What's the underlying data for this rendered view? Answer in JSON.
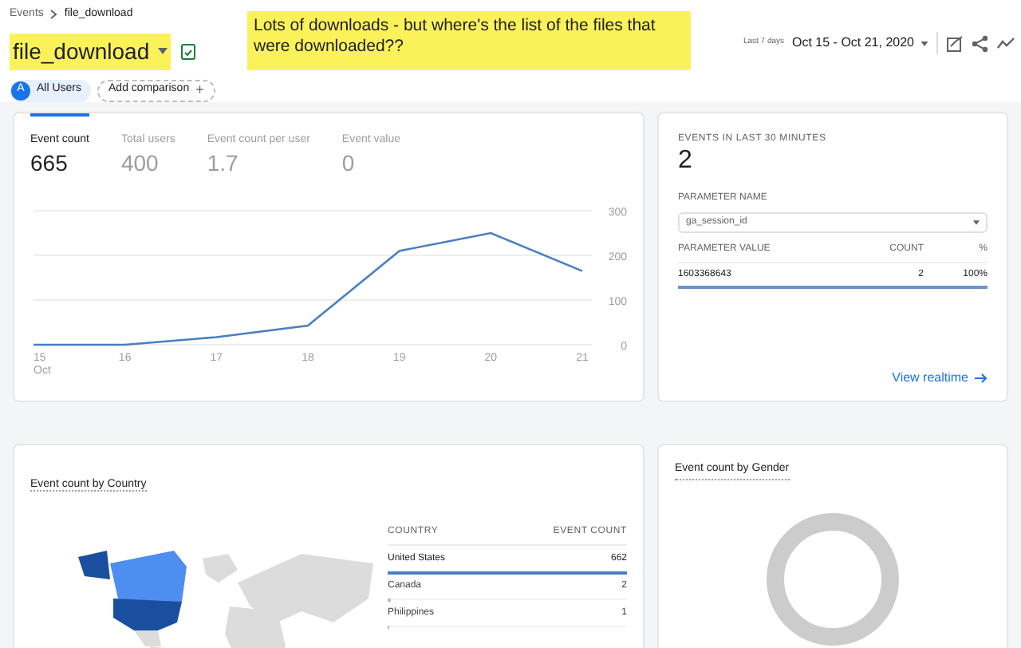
{
  "breadcrumb": [
    "Events",
    "file_download"
  ],
  "title": "file_download",
  "annotation": "Lots of downloads - but where's the list of the files that were downloaded??",
  "date_range": {
    "preset": "Last 7 days",
    "range": "Oct 15 - Oct 21, 2020"
  },
  "segments": [
    {
      "kind": "chip",
      "badge": "A",
      "label": "All Users"
    },
    {
      "kind": "add",
      "label": "Add comparison",
      "icon": "+"
    }
  ],
  "metrics": [
    {
      "label": "Event count",
      "value": "665",
      "selected": true
    },
    {
      "label": "Total users",
      "value": "400",
      "selected": false
    },
    {
      "label": "Event count per user",
      "value": "1.7",
      "selected": false
    },
    {
      "label": "Event value",
      "value": "0",
      "selected": false
    }
  ],
  "chart_month": "Oct",
  "chart_data": {
    "type": "line",
    "categories": [
      "15",
      "16",
      "17",
      "18",
      "19",
      "20",
      "21"
    ],
    "series": [
      {
        "color": "#4a7fc1",
        "values": [
          0,
          0,
          17,
          43,
          210,
          250,
          165
        ]
      }
    ],
    "ylim": [
      0,
      300
    ],
    "yticks": [
      0,
      100,
      200,
      300
    ]
  },
  "realtime": {
    "heading": "EVENTS IN LAST 30 MINUTES",
    "value": "2",
    "param_label": "PARAMETER NAME",
    "param_value": "ga_session_id",
    "columns": [
      "PARAMETER VALUE",
      "COUNT",
      "%"
    ],
    "rows": [
      {
        "value": "1603368643",
        "count": "2",
        "percent": "100%",
        "level": 1
      }
    ],
    "link": "View realtime"
  },
  "country_card": {
    "title": "Event count by Country",
    "columns": [
      "COUNTRY",
      "EVENT COUNT"
    ],
    "rows": [
      {
        "country": "United States",
        "count": "662",
        "level": 1,
        "selected": true
      },
      {
        "country": "Canada",
        "count": "2",
        "level": 0.01,
        "selected": false
      },
      {
        "country": "Philippines",
        "count": "1",
        "level": 0.005,
        "selected": false
      }
    ]
  },
  "gender_card": {
    "title": "Event count by Gender"
  }
}
